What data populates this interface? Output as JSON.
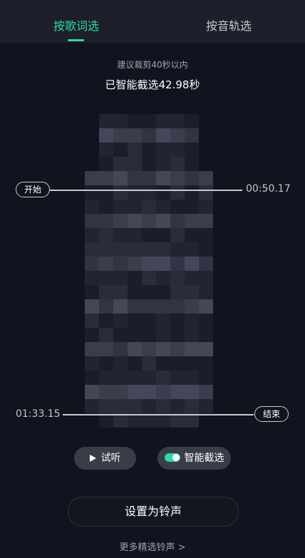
{
  "tabs": [
    {
      "label": "按歌词选",
      "active": true
    },
    {
      "label": "按音轨选",
      "active": false
    }
  ],
  "hint": "建议裁剪40秒以内",
  "selected_duration": "已智能截选42.98秒",
  "start_marker": {
    "label": "开始",
    "time": "00:50.17"
  },
  "end_marker": {
    "label": "结束",
    "time": "01:33.15"
  },
  "controls": {
    "preview_label": "试听",
    "smart_select_label": "智能截选",
    "smart_select_enabled": true
  },
  "primary_action": "设置为铃声",
  "more_link": "更多精选铃声 >",
  "colors": {
    "accent": "#2fd9a0",
    "background": "#11131f"
  },
  "icons": [
    "play-icon",
    "toggle-icon"
  ]
}
